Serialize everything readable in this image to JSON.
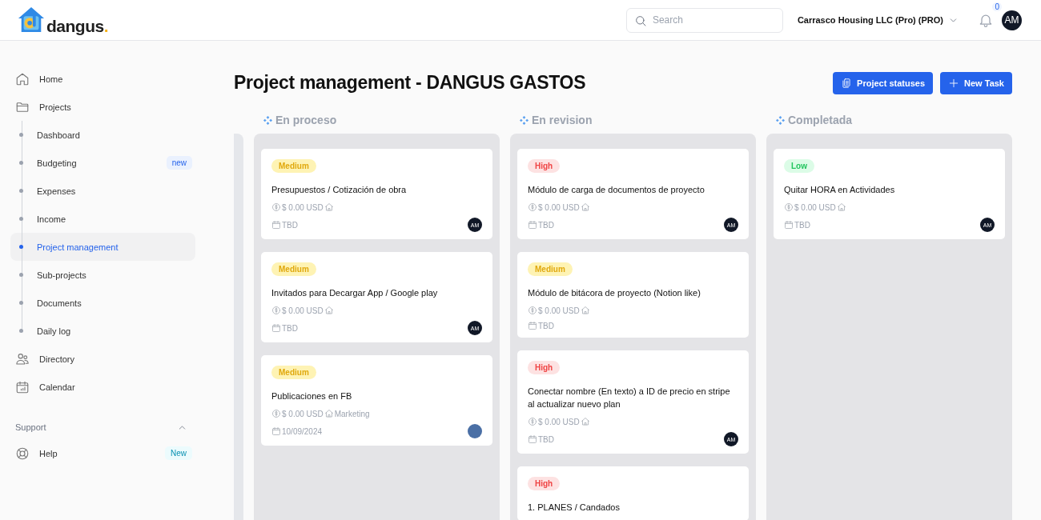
{
  "header": {
    "logo_text": "dangus",
    "logo_dot": ".",
    "search": {
      "placeholder": "Search"
    },
    "company": "Carrasco Housing LLC (Pro) (PRO)",
    "notifications": "0",
    "avatar": "AM"
  },
  "sidebar": {
    "items": [
      {
        "label": "Home",
        "selected": false
      },
      {
        "label": "Projects",
        "selected": false,
        "children": [
          {
            "label": "Dashboard",
            "selected": false
          },
          {
            "label": "Budgeting",
            "selected": false,
            "badge": "new"
          },
          {
            "label": "Expenses",
            "selected": false
          },
          {
            "label": "Income",
            "selected": false
          },
          {
            "label": "Project management",
            "selected": true
          },
          {
            "label": "Sub-projects",
            "selected": false
          },
          {
            "label": "Documents",
            "selected": false
          },
          {
            "label": "Daily log",
            "selected": false
          }
        ]
      },
      {
        "label": "Directory",
        "selected": false
      },
      {
        "label": "Calendar",
        "selected": false
      }
    ],
    "support": {
      "label": "Support",
      "expanded": true,
      "items": [
        {
          "label": "Help",
          "selected": false,
          "badge": "New"
        }
      ]
    }
  },
  "page": {
    "title": "Project management - DANGUS GASTOS",
    "buttons": [
      {
        "label": "Project statuses"
      },
      {
        "label": "New Task"
      }
    ]
  },
  "board": {
    "columns": [
      {
        "title": "En proceso",
        "cards": [
          {
            "priority": "Medium",
            "kind": "medium",
            "title": "Presupuestos / Cotización de obra",
            "amount": "$ 0.00 USD",
            "date": "TBD",
            "assignee": {
              "kind": "initials",
              "text": "AM"
            }
          },
          {
            "priority": "Medium",
            "kind": "medium",
            "title": "Invitados para Decargar App / Google play",
            "amount": "$ 0.00 USD",
            "date": "TBD",
            "assignee": {
              "kind": "initials",
              "text": "AM"
            }
          },
          {
            "priority": "Medium",
            "kind": "medium",
            "title": "Publicaciones en FB",
            "amount": "$ 0.00 USD",
            "category": "Marketing",
            "date": "10/09/2024",
            "assignee": {
              "kind": "photo"
            }
          }
        ]
      },
      {
        "title": "En revision",
        "cards": [
          {
            "priority": "High",
            "kind": "high",
            "title": "Módulo de carga de documentos de proyecto",
            "amount": "$ 0.00 USD",
            "date": "TBD",
            "assignee": {
              "kind": "initials",
              "text": "AM"
            }
          },
          {
            "priority": "Medium",
            "kind": "medium",
            "title": "Módulo de bitácora de proyecto (Notion like)",
            "amount": "$ 0.00 USD",
            "date": "TBD"
          },
          {
            "priority": "High",
            "kind": "high",
            "title": "Conectar nombre (En texto) a ID de precio en stripe al actualizar nuevo plan",
            "amount": "$ 0.00 USD",
            "date": "TBD",
            "assignee": {
              "kind": "initials",
              "text": "AM"
            }
          },
          {
            "priority": "High",
            "kind": "high",
            "title": "1. PLANES / Candados"
          }
        ]
      },
      {
        "title": "Completada",
        "cards": [
          {
            "priority": "Low",
            "kind": "low",
            "title": "Quitar HORA en Actividades",
            "amount": "$ 0.00 USD",
            "date": "TBD",
            "assignee": {
              "kind": "initials",
              "text": "AM"
            }
          }
        ]
      }
    ]
  }
}
